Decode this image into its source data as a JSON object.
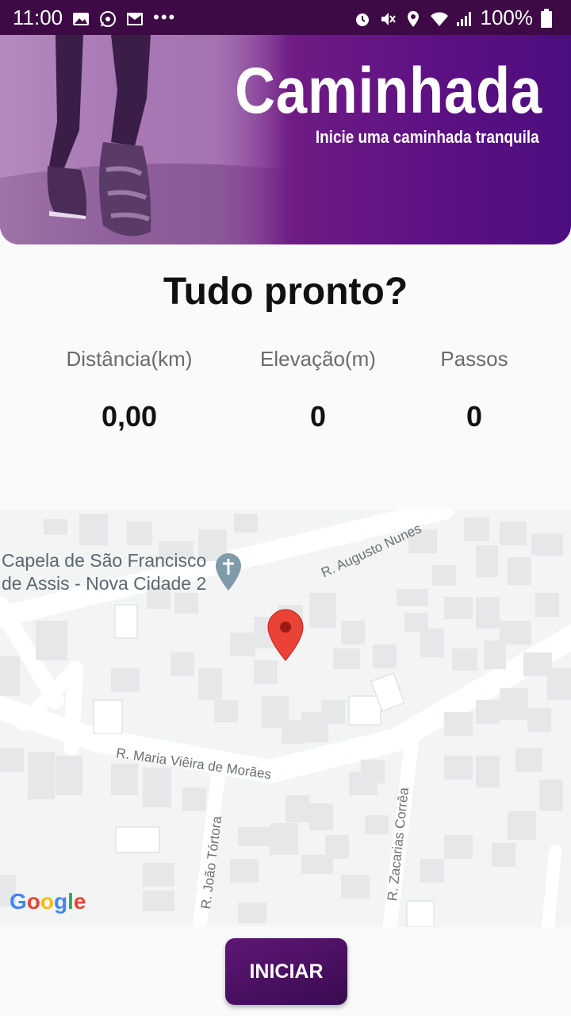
{
  "status_bar": {
    "time": "11:00",
    "battery": "100%",
    "left_icons": [
      "image-icon",
      "whatsapp-icon",
      "gmail-icon",
      "more-dots-icon"
    ],
    "right_icons": [
      "alarm-icon",
      "mute-icon",
      "location-icon",
      "wifi-icon",
      "signal-icon",
      "battery-icon"
    ]
  },
  "banner": {
    "title": "Caminhada",
    "subtitle": "Inicie uma caminhada tranquila"
  },
  "heading": "Tudo pronto?",
  "stats": [
    {
      "label": "Distância(km)",
      "value": "0,00"
    },
    {
      "label": "Elevação(m)",
      "value": "0"
    },
    {
      "label": "Passos",
      "value": "0"
    }
  ],
  "map": {
    "poi_line1": "Capela de São Francisco",
    "poi_line2": "de Assis - Nova Cidade 2",
    "streets": {
      "augusto_nunes": "R. Augusto Nunes",
      "maria_vieira": "R. Maria Viêira de Morães",
      "joao_tortora": "R. João Tórtora",
      "zacarias_correa": "R. Zacarias Corrêa"
    },
    "logo": "Google"
  },
  "start_button": "INICIAR",
  "colors": {
    "status_bar": "#3d0a45",
    "banner_purple": "#5a1083",
    "button": "#4a0f63",
    "marker": "#ea4335"
  }
}
